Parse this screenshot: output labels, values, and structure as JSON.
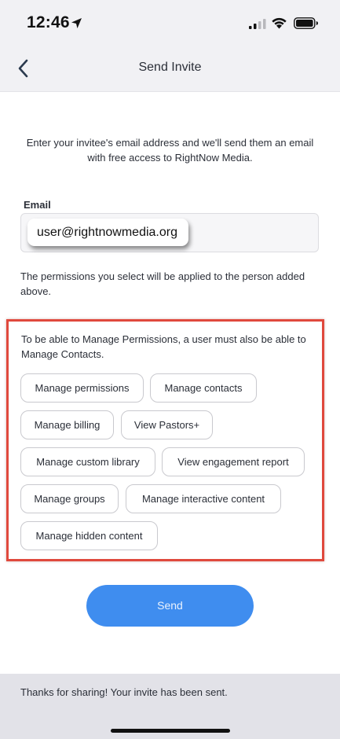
{
  "status_bar": {
    "time": "12:46",
    "icons": [
      "location-arrow-icon",
      "signal-icon",
      "wifi-icon",
      "battery-icon"
    ]
  },
  "nav": {
    "back_icon": "chevron-left-icon",
    "title": "Send Invite"
  },
  "intro": "Enter your invitee's email address and we'll send them an email with free access to RightNow Media.",
  "email": {
    "label": "Email",
    "value": "user@rightnowmedia.org"
  },
  "permissions_note": "The permissions you select will be applied to the person added above.",
  "permissions": {
    "warning": "To be able to Manage Permissions, a user must also be able to Manage Contacts.",
    "options": [
      "Manage permissions",
      "Manage contacts",
      "Manage billing",
      "View Pastors+",
      "Manage custom library",
      "View engagement report",
      "Manage groups",
      "Manage interactive content",
      "Manage hidden content"
    ]
  },
  "send_button": "Send",
  "toast": "Thanks for sharing! Your invite has been sent.",
  "colors": {
    "accent": "#3f8def",
    "highlight_border": "#e0493d",
    "background": "#f1f1f4"
  }
}
